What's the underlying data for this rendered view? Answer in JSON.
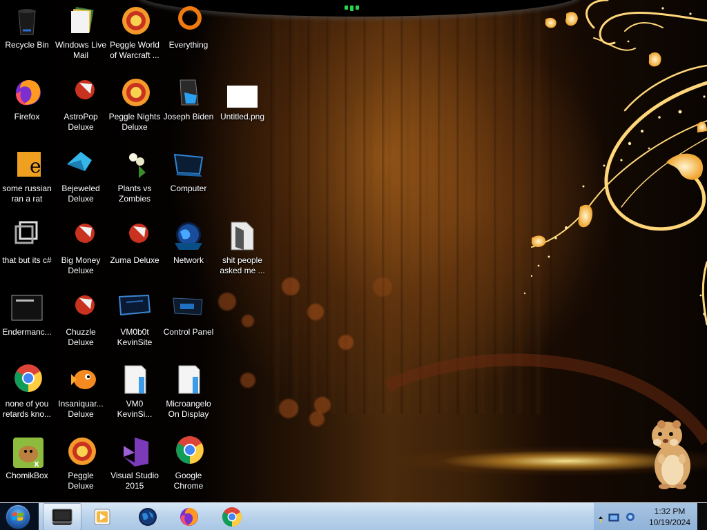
{
  "desktop": {
    "icons": [
      {
        "id": "recycle-bin",
        "label": "Recycle Bin",
        "icon": "recycle-bin-icon"
      },
      {
        "id": "windows-live-mail",
        "label": "Windows Live\nMail",
        "icon": "mail-icon"
      },
      {
        "id": "peggle-world-of-warcraft",
        "label": "Peggle World\nof Warcraft ...",
        "icon": "peggle-icon"
      },
      {
        "id": "everything",
        "label": "Everything",
        "icon": "search-app-icon"
      },
      {
        "id": "firefox",
        "label": "Firefox",
        "icon": "firefox-icon"
      },
      {
        "id": "astropop-deluxe",
        "label": "AstroPop\nDeluxe",
        "icon": "game-icon"
      },
      {
        "id": "peggle-nights-deluxe",
        "label": "Peggle Nights\nDeluxe",
        "icon": "peggle-icon"
      },
      {
        "id": "joseph-biden",
        "label": "Joseph Biden",
        "icon": "user-folder-icon"
      },
      {
        "id": "untitled-png",
        "label": "Untitled.png",
        "icon": "image-file-icon"
      },
      {
        "id": "some-russian-ran-a-rat",
        "label": "some russian\nran a rat",
        "icon": "app-icon"
      },
      {
        "id": "bejeweled-deluxe",
        "label": "Bejeweled\nDeluxe",
        "icon": "gem-icon"
      },
      {
        "id": "plants-vs-zombies",
        "label": "Plants vs\nZombies",
        "icon": "plant-icon"
      },
      {
        "id": "computer",
        "label": "Computer",
        "icon": "computer-icon"
      },
      {
        "id": "that-but-its-csharp",
        "label": "that but its c#",
        "icon": "shortcut-icon"
      },
      {
        "id": "big-money-deluxe",
        "label": "Big Money\nDeluxe",
        "icon": "game-icon"
      },
      {
        "id": "zuma-deluxe",
        "label": "Zuma Deluxe",
        "icon": "game-icon"
      },
      {
        "id": "network",
        "label": "Network",
        "icon": "network-globe-icon"
      },
      {
        "id": "shit-people-asked-me",
        "label": "shit people\nasked me ...",
        "icon": "folder-icon"
      },
      {
        "id": "endermanch",
        "label": "Endermanc...",
        "icon": "console-icon"
      },
      {
        "id": "chuzzle-deluxe",
        "label": "Chuzzle\nDeluxe",
        "icon": "game-icon"
      },
      {
        "id": "vm0b0t-kevinsite",
        "label": "VM0b0t\nKevinSite",
        "icon": "monitor-icon"
      },
      {
        "id": "control-panel",
        "label": "Control Panel",
        "icon": "control-panel-icon"
      },
      {
        "id": "none-of-you-retards",
        "label": "none of you\nretards kno...",
        "icon": "chrome-icon"
      },
      {
        "id": "insaniquarium-deluxe",
        "label": "Insaniquar...\nDeluxe",
        "icon": "fish-icon"
      },
      {
        "id": "vm0-kevinsi",
        "label": "VM0\nKevinSi...",
        "icon": "document-icon"
      },
      {
        "id": "microangelo-on-display",
        "label": "Microangelo\nOn Display",
        "icon": "document-icon"
      },
      {
        "id": "chomikbox",
        "label": "ChomikBox",
        "icon": "hamster-app-icon"
      },
      {
        "id": "peggle-deluxe",
        "label": "Peggle Deluxe",
        "icon": "peggle-icon"
      },
      {
        "id": "visual-studio-2015",
        "label": "Visual Studio\n2015",
        "icon": "visual-studio-icon"
      },
      {
        "id": "google-chrome",
        "label": "Google\nChrome",
        "icon": "chrome-icon"
      }
    ]
  },
  "taskbar": {
    "start_label": "Start",
    "pinned": [
      {
        "name": "explorer",
        "icon": "explorer-window-icon"
      },
      {
        "name": "media-player",
        "icon": "media-player-icon"
      },
      {
        "name": "network-app",
        "icon": "globe-icon"
      },
      {
        "name": "firefox",
        "icon": "firefox-icon"
      },
      {
        "name": "chrome",
        "icon": "chrome-icon"
      }
    ],
    "tray": {
      "icons": [
        "show-hidden-icons",
        "network-tray-icon",
        "volume-tray-icon"
      ],
      "time": "1:32 PM",
      "date": "10/19/2024"
    }
  },
  "colors": {
    "taskbar": "#bcd4ec",
    "label_text": "#ffffff",
    "wallpaper_glow": "#f2b53a"
  }
}
